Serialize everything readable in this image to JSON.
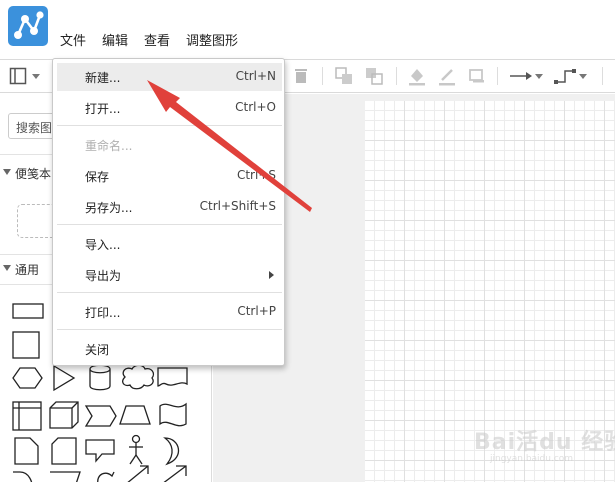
{
  "menubar": {
    "items": [
      "文件",
      "编辑",
      "查看",
      "调整图形"
    ]
  },
  "sidebar": {
    "search_placeholder": "搜索图",
    "section_scratchpad": "便笺本",
    "section_general": "通用"
  },
  "file_menu": {
    "items": [
      {
        "label": "新建...",
        "shortcut": "Ctrl+N",
        "state": "hover"
      },
      {
        "label": "打开...",
        "shortcut": "Ctrl+O",
        "state": "normal"
      },
      {
        "label": "重命名...",
        "shortcut": "",
        "state": "disabled"
      },
      {
        "label": "保存",
        "shortcut": "Ctrl+S",
        "state": "normal"
      },
      {
        "label": "另存为...",
        "shortcut": "Ctrl+Shift+S",
        "state": "normal"
      },
      {
        "label": "导入...",
        "shortcut": "",
        "state": "normal"
      },
      {
        "label": "导出为",
        "shortcut": "",
        "state": "submenu"
      },
      {
        "label": "打印...",
        "shortcut": "Ctrl+P",
        "state": "normal"
      },
      {
        "label": "关闭",
        "shortcut": "",
        "state": "normal"
      }
    ]
  },
  "icons": {
    "app_logo": "drawio-logo",
    "toolbar": [
      "view-toggle-icon",
      "delete-icon",
      "to-front-icon",
      "to-back-icon",
      "fill-color-icon",
      "line-color-icon",
      "shadow-icon",
      "connection-icon",
      "waypoints-icon"
    ]
  },
  "colors": {
    "logo_blue": "#3b91dc",
    "annotation_red": "#e0413b",
    "menu_hover": "#ececec",
    "disabled_text": "#b0b0b0"
  },
  "watermark": {
    "brand": "Bai活du 经验",
    "url": "jingyan.baidu.com"
  }
}
